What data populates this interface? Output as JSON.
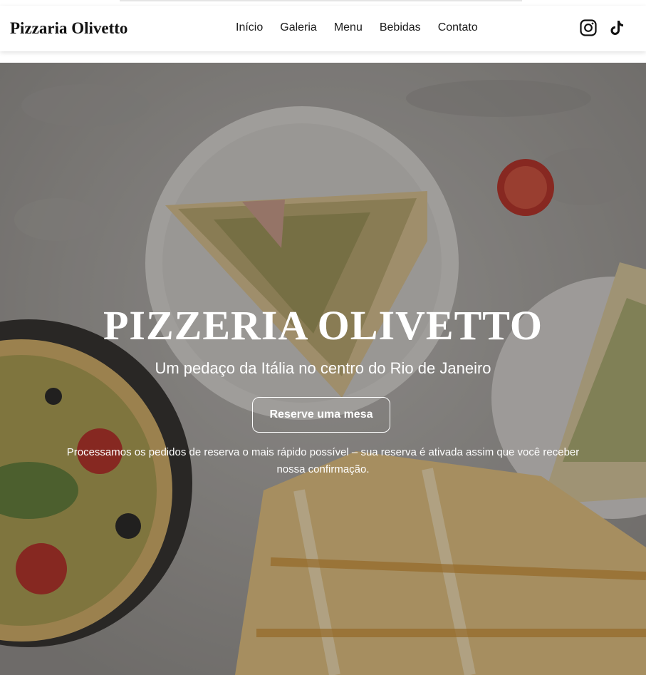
{
  "brand": "Pizzaria Olivetto",
  "nav": {
    "items": [
      "Início",
      "Galeria",
      "Menu",
      "Bebidas",
      "Contato"
    ]
  },
  "social": {
    "icons": [
      "instagram-icon",
      "tiktok-icon"
    ]
  },
  "hero": {
    "title": "PIZZERIA OLIVETTO",
    "subtitle": "Um pedaço da Itália no centro do Rio de Janeiro",
    "cta_label": "Reserve uma mesa",
    "note": "Processamos os pedidos de reserva o mais rápido possível – sua reserva é ativada assim que você receber nossa confirmação."
  },
  "colors": {
    "text_dark": "#111111",
    "overlay": "#28262452",
    "white": "#ffffff"
  }
}
